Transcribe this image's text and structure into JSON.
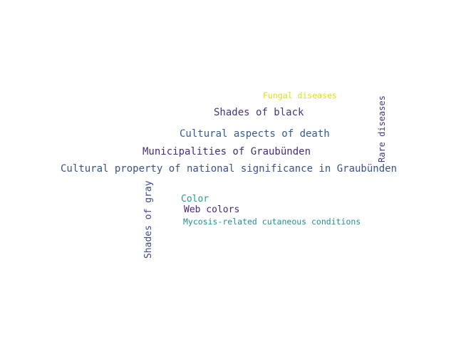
{
  "word_cloud": {
    "words": [
      {
        "text": "Fungal diseases",
        "color": "#d8e219"
      },
      {
        "text": "Shades of black",
        "color": "#46337e"
      },
      {
        "text": "Cultural aspects of death",
        "color": "#365c8d"
      },
      {
        "text": "Municipalities of Graubünden",
        "color": "#472d7b"
      },
      {
        "text": "Cultural property of national significance in Graubünden",
        "color": "#3b528b"
      },
      {
        "text": "Color",
        "color": "#1fa188"
      },
      {
        "text": "Web colors",
        "color": "#482878"
      },
      {
        "text": "Mycosis-related cutaneous conditions",
        "color": "#21918c"
      },
      {
        "text": "Rare diseases",
        "color": "#443983"
      },
      {
        "text": "Shades of gray",
        "color": "#3e4a89"
      }
    ]
  }
}
